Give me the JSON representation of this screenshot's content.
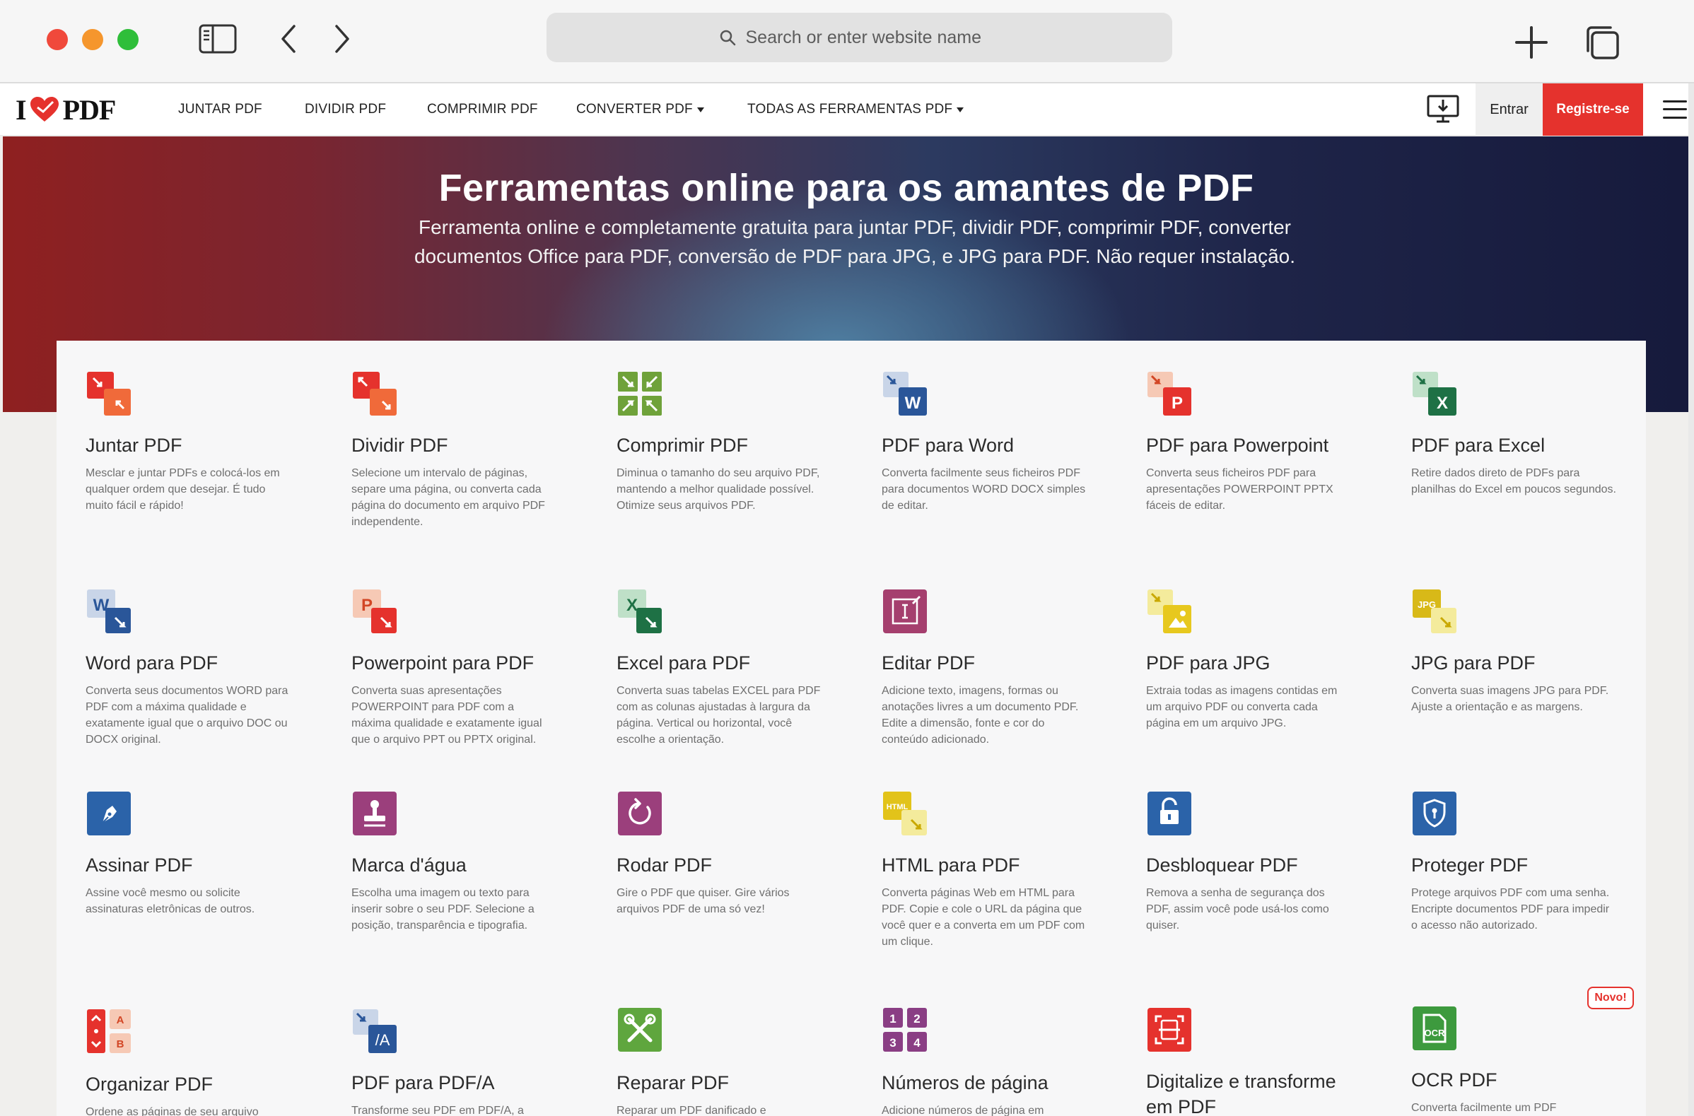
{
  "browser": {
    "search_placeholder": "Search or enter website name"
  },
  "site_nav": {
    "logo_left": "I",
    "logo_right": "PDF",
    "links": [
      "JUNTAR PDF",
      "DIVIDIR PDF",
      "COMPRIMIR PDF",
      "CONVERTER PDF",
      "TODAS AS FERRAMENTAS PDF"
    ],
    "login_label": "Entrar",
    "signup_label": "Registre-se"
  },
  "hero": {
    "title": "Ferramentas online para os amantes de PDF",
    "subtitle": "Ferramenta online e completamente gratuita para juntar PDF, dividir PDF, comprimir PDF, converter documentos Office para PDF, conversão de PDF para JPG, e JPG para PDF. Não requer instalação."
  },
  "tools": [
    {
      "name": "Juntar PDF",
      "desc": "Mesclar e juntar PDFs e colocá-los em qualquer ordem que desejar. É tudo muito fácil e rápido!"
    },
    {
      "name": "Dividir PDF",
      "desc": "Selecione um intervalo de páginas, separe uma página, ou converta cada página do documento em arquivo PDF independente."
    },
    {
      "name": "Comprimir PDF",
      "desc": "Diminua o tamanho do seu arquivo PDF, mantendo a melhor qualidade possível. Otimize seus arquivos PDF."
    },
    {
      "name": "PDF para Word",
      "desc": "Converta facilmente seus ficheiros PDF para documentos WORD DOCX simples de editar."
    },
    {
      "name": "PDF para Powerpoint",
      "desc": "Converta seus ficheiros PDF para apresentações POWERPOINT PPTX fáceis de editar."
    },
    {
      "name": "PDF para Excel",
      "desc": "Retire dados direto de PDFs para planilhas do Excel em poucos segundos."
    },
    {
      "name": "Word para PDF",
      "desc": "Converta seus documentos WORD para PDF com a máxima qualidade e exatamente igual que o arquivo DOC ou DOCX original."
    },
    {
      "name": "Powerpoint para PDF",
      "desc": "Converta suas apresentações POWERPOINT para PDF com a máxima qualidade e exatamente igual que o arquivo PPT ou PPTX original."
    },
    {
      "name": "Excel para PDF",
      "desc": "Converta suas tabelas EXCEL para PDF com as colunas ajustadas à largura da página. Vertical ou horizontal, você escolhe a orientação."
    },
    {
      "name": "Editar PDF",
      "desc": "Adicione texto, imagens, formas ou anotações livres a um documento PDF. Edite a dimensão, fonte e cor do conteúdo adicionado."
    },
    {
      "name": "PDF para JPG",
      "desc": "Extraia todas as imagens contidas em um arquivo PDF ou converta cada página em um arquivo JPG."
    },
    {
      "name": "JPG para PDF",
      "desc": "Converta suas imagens JPG para PDF. Ajuste a orientação e as margens."
    },
    {
      "name": "Assinar PDF",
      "desc": "Assine você mesmo ou solicite assinaturas eletrônicas de outros."
    },
    {
      "name": "Marca d'água",
      "desc": "Escolha uma imagem ou texto para inserir sobre o seu PDF. Selecione a posição, transparência e tipografia."
    },
    {
      "name": "Rodar PDF",
      "desc": "Gire o PDF que quiser. Gire vários arquivos PDF de uma só vez!"
    },
    {
      "name": "HTML para PDF",
      "desc": "Converta páginas Web em HTML para PDF. Copie e cole o URL da página que você quer e a converta em um PDF com um clique."
    },
    {
      "name": "Desbloquear PDF",
      "desc": "Remova a senha de segurança dos PDF, assim você pode usá-los como quiser."
    },
    {
      "name": "Proteger PDF",
      "desc": "Protege arquivos PDF com uma senha. Encripte documentos PDF para impedir o acesso não autorizado."
    },
    {
      "name": "Organizar PDF",
      "desc": "Ordene as páginas de seu arquivo"
    },
    {
      "name": "PDF para PDF/A",
      "desc": "Transforme seu PDF em PDF/A, a"
    },
    {
      "name": "Reparar PDF",
      "desc": "Reparar um PDF danificado e"
    },
    {
      "name": "Números de página",
      "desc": "Adicione números de página em"
    },
    {
      "name": "Digitalize e transforme em PDF",
      "desc": ""
    },
    {
      "name": "OCR PDF",
      "desc": "Converta facilmente um PDF"
    }
  ],
  "badge": {
    "label": "Novo!"
  },
  "icons": {
    "doc_w": "W",
    "doc_p": "P",
    "doc_x": "X",
    "jpg": "JPG",
    "html": "HTML",
    "pdfa": "/A",
    "org_a": "A",
    "org_b": "B",
    "n1": "1",
    "n2": "2",
    "n3": "3",
    "n4": "4",
    "ocr": "OCR"
  },
  "colors": {
    "brand_red": "#e5322d",
    "merge_orange": "#e5322d",
    "compress_green": "#6fa23a",
    "word_blue": "#2a5699",
    "ppt_orange": "#d24625",
    "excel_green": "#1e7145",
    "edit_purple": "#a53f6e",
    "jpg_yellow": "#e7c81e",
    "sign_blue": "#2b63a9",
    "watermark_purple": "#9b3f7c",
    "html_yellow": "#e9d21f",
    "repair_green": "#5fa63e",
    "pagenum_purple": "#8a3e84",
    "ocr_green": "#3d9a3e"
  }
}
